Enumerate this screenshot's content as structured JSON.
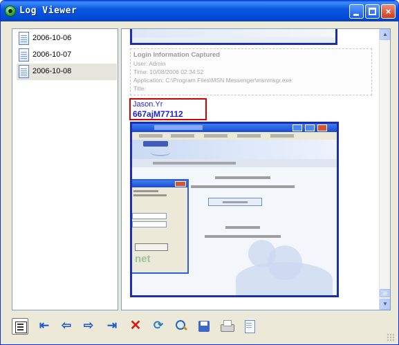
{
  "window": {
    "title": "Log Viewer",
    "controls": {
      "minimize": "minimize",
      "maximize": "maximize",
      "close": "×"
    }
  },
  "dates": [
    "2006-10-06",
    "2006-10-07",
    "2006-10-08"
  ],
  "selected_date": "2006-10-08",
  "log_entry": {
    "heading": "Login Information Captured",
    "user": "User: Admin",
    "time": "Time: 10/08/2006 02:34:52",
    "application": "Application: C:\\Program Files\\MSN Messenger\\msnmsgr.exe",
    "title": "Title:",
    "captured_username": "Jason.Yr",
    "captured_password": "667ajM77112"
  },
  "captured_window": {
    "net_logo": "net"
  },
  "toolbar": {
    "icons": [
      "view-icon",
      "first-icon",
      "previous-icon",
      "next-icon",
      "last-icon",
      "delete-icon",
      "refresh-icon",
      "find-icon",
      "save-icon",
      "print-icon",
      "document-icon"
    ]
  },
  "colors": {
    "title_bar": "#0b58e0",
    "credential_border": "#d00000",
    "credential_text": "#1f1fd8",
    "capture_border": "#1a2fa8"
  }
}
